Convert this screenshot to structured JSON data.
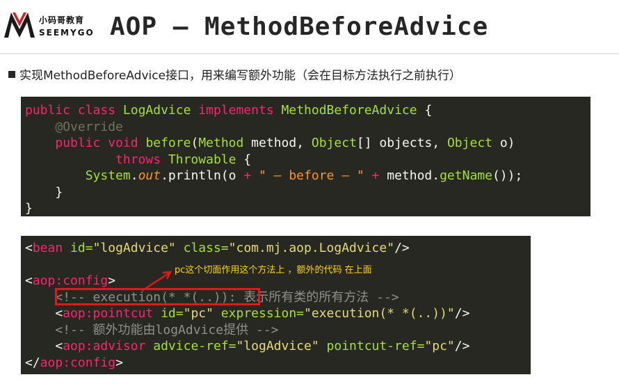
{
  "header": {
    "logo_cn": "小码哥教育",
    "logo_en": "SEEMYGO",
    "title": "AOP – MethodBeforeAdvice"
  },
  "bullet": {
    "text": "实现MethodBeforeAdvice接口，用来编写额外功能（会在目标方法执行之前执行）"
  },
  "code_java": {
    "l1_public": "public",
    "l1_class": "class",
    "l1_name": "LogAdvice",
    "l1_implements": "implements",
    "l1_iface": "MethodBeforeAdvice",
    "l1_brace": "{",
    "l2_annotation": "@Override",
    "l3_public": "public",
    "l3_void": "void",
    "l3_method": "before",
    "l3_p1": "(",
    "l3_t1": "Method",
    "l3_p2": " method, ",
    "l3_t2": "Object",
    "l3_p3": "[] objects, ",
    "l3_t3": "Object",
    "l3_p4": " o)",
    "l4_throws": "throws",
    "l4_type": "Throwable",
    "l4_brace": " {",
    "l5_class": "System",
    "l5_dot1": ".",
    "l5_out": "out",
    "l5_call": ".println(o ",
    "l5_plus1": "+",
    "l5_str": " \" – before – \" ",
    "l5_plus2": "+",
    "l5_mid": " method.",
    "l5_getname": "getName",
    "l5_end": "());",
    "l6_brace": "}",
    "l7_brace": "}"
  },
  "code_xml": {
    "b_open": "<",
    "b_tag": "bean",
    "b_attr1": " id=",
    "b_val1": "\"logAdvice\"",
    "b_attr2": " class=",
    "b_val2": "\"com.mj.aop.LogAdvice\"",
    "b_close": "/>",
    "c_open": "<",
    "c_tag": "aop:config",
    "c_close": ">",
    "cm1_a": "<!-- execution(* *(..)):",
    "cm1_b": " 表示所有类的所有方法 -->",
    "p_open": "<",
    "p_tag": "aop:pointcut",
    "p_attr1": " id=",
    "p_val1": "\"pc\"",
    "p_attr2": " expression=",
    "p_val2": "\"execution(* *(..))\"",
    "p_close": "/>",
    "cm2": "<!-- 额外功能由logAdvice提供 -->",
    "a_open": "<",
    "a_tag": "aop:advisor",
    "a_attr1": " advice-ref=",
    "a_val1": "\"logAdvice\"",
    "a_attr2": " pointcut-ref=",
    "a_val2": "\"pc\"",
    "a_close": "/>",
    "e_open": "</",
    "e_tag": "aop:config",
    "e_close": ">"
  },
  "annotation": {
    "note": "pc这个切面作用这个方法上  ，额外的代码 在上面"
  },
  "colors": {
    "code_bg": "#272822",
    "keyword": "#f92672",
    "type": "#a6e22e",
    "string": "#e6db74",
    "comment": "#8f8f8f",
    "highlight": "#e0191b",
    "note": "#ffd700"
  },
  "icons": [
    "seemygo-logo-icon",
    "arrow-icon",
    "highlight-box"
  ]
}
